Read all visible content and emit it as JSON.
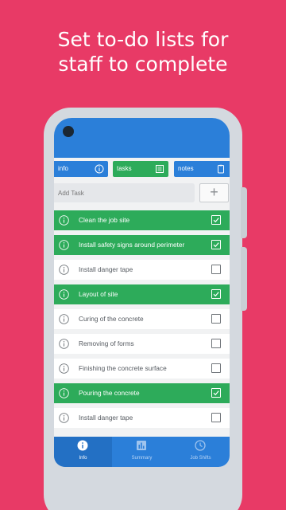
{
  "headline": {
    "line1": "Set to-do lists for",
    "line2": "staff to complete"
  },
  "colors": {
    "background": "#e83a66",
    "primary_blue": "#2b7fd9",
    "done_green": "#2dab5a"
  },
  "tabs": [
    {
      "label": "info",
      "icon": "info-icon"
    },
    {
      "label": "tasks",
      "icon": "list-icon"
    },
    {
      "label": "notes",
      "icon": "clipboard-icon"
    }
  ],
  "add_task": {
    "placeholder": "Add Task",
    "button_label": "+"
  },
  "tasks": [
    {
      "label": "Clean the job site",
      "done": true
    },
    {
      "label": "Install safety signs around perimeter",
      "done": true
    },
    {
      "label": "Install danger tape",
      "done": false
    },
    {
      "label": "Layout of site",
      "done": true
    },
    {
      "label": "Curing of the concrete",
      "done": false
    },
    {
      "label": "Removing of forms",
      "done": false
    },
    {
      "label": "Finishing the concrete surface",
      "done": false
    },
    {
      "label": "Pouring the concrete",
      "done": true
    },
    {
      "label": "Install danger tape",
      "done": false
    }
  ],
  "bottom_nav": [
    {
      "label": "Info",
      "icon": "info-icon",
      "active": true
    },
    {
      "label": "Summary",
      "icon": "bar-chart-icon",
      "active": false
    },
    {
      "label": "Job Shifts",
      "icon": "clock-icon",
      "active": false
    }
  ]
}
